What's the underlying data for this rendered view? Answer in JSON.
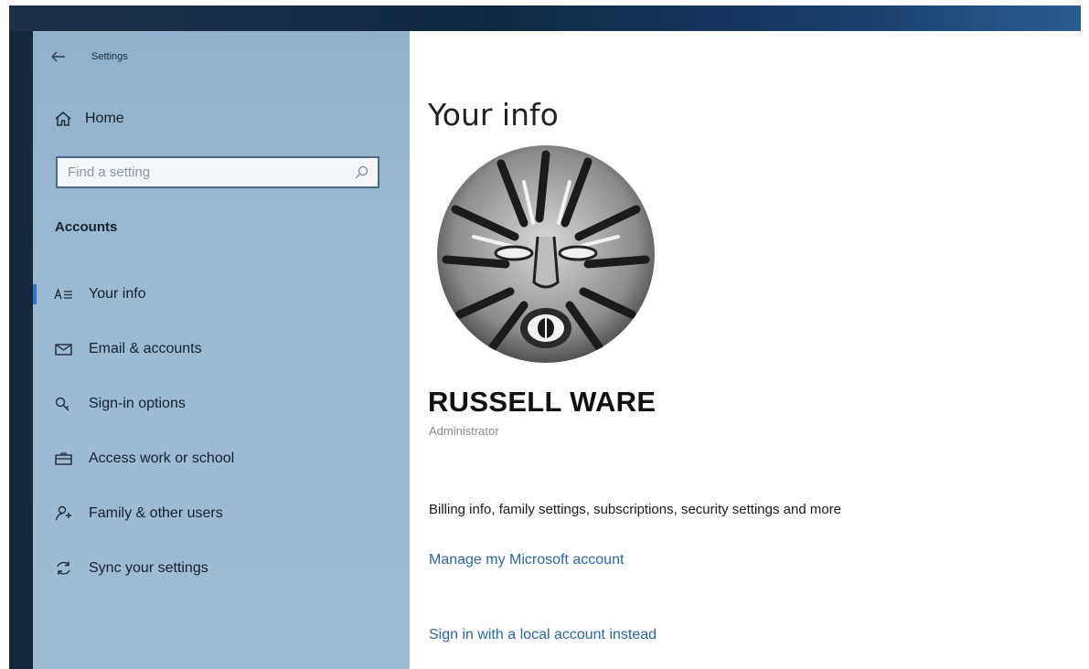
{
  "window": {
    "title": "Settings"
  },
  "sidebar": {
    "home_label": "Home",
    "search_placeholder": "Find a setting",
    "section_title": "Accounts",
    "items": [
      {
        "label": "Your info",
        "icon": "person-card-icon",
        "selected": true
      },
      {
        "label": "Email & accounts",
        "icon": "mail-icon",
        "selected": false
      },
      {
        "label": "Sign-in options",
        "icon": "key-icon",
        "selected": false
      },
      {
        "label": "Access work or school",
        "icon": "briefcase-icon",
        "selected": false
      },
      {
        "label": "Family & other users",
        "icon": "person-add-icon",
        "selected": false
      },
      {
        "label": "Sync your settings",
        "icon": "sync-icon",
        "selected": false
      }
    ]
  },
  "main": {
    "page_title": "Your info",
    "user_name": "RUSSELL WARE",
    "user_role": "Administrator",
    "billing_text": "Billing info, family settings, subscriptions, security settings and more",
    "manage_link": "Manage my Microsoft account",
    "local_link": "Sign in with a local account instead"
  },
  "colors": {
    "accent": "#2f77c6",
    "link": "#2a64aa",
    "sidebar_bg": "#9cbad2",
    "titlebar": "#0f2744"
  }
}
